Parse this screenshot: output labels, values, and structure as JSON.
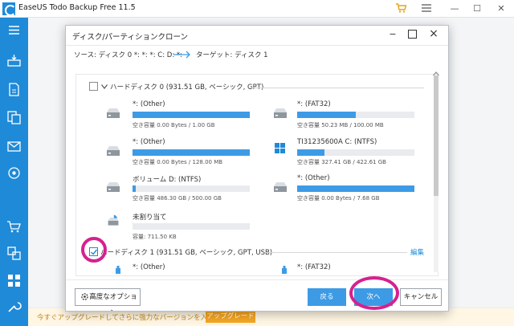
{
  "app": {
    "title": "EaseUS Todo Backup Free 11.5",
    "min": "—",
    "max": "☐",
    "close": "✕"
  },
  "promo": {
    "text": "今すぐアップグレードしてさらに強力なバージョンを入手しましょう。",
    "button": "アップグレード"
  },
  "dialog": {
    "title": "ディスク/パーティションクローン",
    "source": "ソース:  ディスク 0 *: *: *: C: D: *:",
    "target": "ターゲット:  ディスク 1",
    "disk0": {
      "header": "ハードディスク 0 (931.51 GB, ベーシック, GPT)"
    },
    "disk1": {
      "header": "ハードディスク 1 (931.51 GB, ベーシック, GPT, USB)",
      "edit": "編集"
    },
    "partitions": [
      {
        "name": "*: (Other)",
        "info": "空き容量 0.00 Bytes / 1.00 GB",
        "fill": 1.0
      },
      {
        "name": "*: (FAT32)",
        "info": "空き容量 50.23 MB / 100.00 MB",
        "fill": 0.5
      },
      {
        "name": "*: (Other)",
        "info": "空き容量 0.00 Bytes / 128.00 MB",
        "fill": 1.0
      },
      {
        "name": "TI31235600A C: (NTFS)",
        "info": "空き容量 327.41 GB / 422.61 GB",
        "fill": 0.23
      },
      {
        "name": "ボリューム D: (NTFS)",
        "info": "空き容量 486.30 GB / 500.00 GB",
        "fill": 0.03
      },
      {
        "name": "*: (Other)",
        "info": "空き容量 0.00 Bytes / 7.68 GB",
        "fill": 1.0
      },
      {
        "name": "未割り当て",
        "info": "容量: 711.50 KB",
        "fill": 0
      }
    ],
    "disk1_partitions": [
      {
        "name": "*: (Other)"
      },
      {
        "name": "*: (FAT32)"
      }
    ],
    "buttons": {
      "advanced": "高度なオプション",
      "back": "戻る",
      "next": "次へ",
      "cancel": "キャンセル"
    }
  }
}
